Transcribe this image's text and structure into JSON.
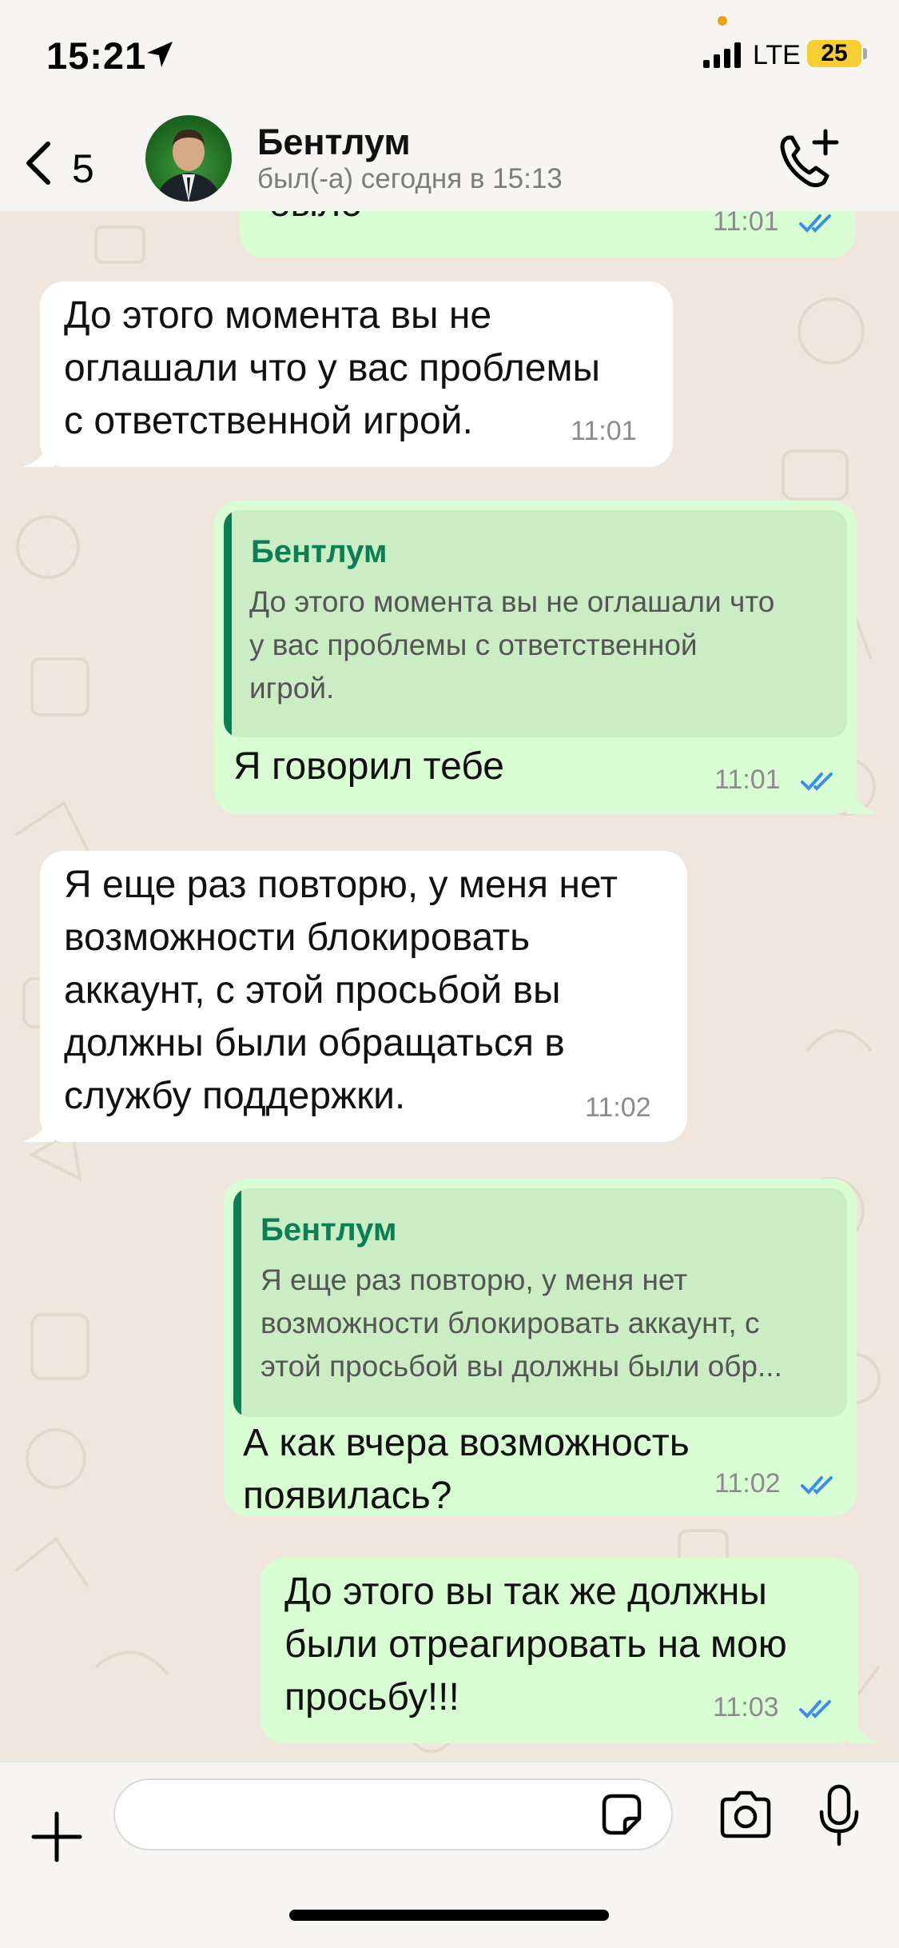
{
  "status_bar": {
    "time": "15:21",
    "network": "LTE",
    "battery": "25"
  },
  "header": {
    "back_count": "5",
    "contact_name": "Бентлум",
    "contact_status": "был(-а) сегодня в 15:13"
  },
  "messages": [
    {
      "direction": "out",
      "text": "было",
      "time": "11:01",
      "read": true
    },
    {
      "direction": "in",
      "text": "До этого момента вы не\nоглашали что у вас проблемы\nс ответственной игрой.",
      "time": "11:01"
    },
    {
      "direction": "out",
      "quote": {
        "author": "Бентлум",
        "text": "До этого момента вы не оглашали что\nу вас проблемы с ответственной\nигрой."
      },
      "text": "Я говорил тебе",
      "time": "11:01",
      "read": true
    },
    {
      "direction": "in",
      "text": "Я еще раз повторю, у меня нет\nвозможности блокировать\nаккаунт, с этой просьбой вы\nдолжны были обращаться в\nслужбу поддержки.",
      "time": "11:02"
    },
    {
      "direction": "out",
      "quote": {
        "author": "Бентлум",
        "text": "Я еще раз повторю, у меня нет\nвозможности блокировать аккаунт, с\nэтой просьбой вы должны были обр..."
      },
      "text": "А как вчера возможность\nпоявилась?",
      "time": "11:02",
      "read": true
    },
    {
      "direction": "out",
      "text": "До этого вы так же должны\nбыли отреагировать на мою\nпросьбу!!!",
      "time": "11:03",
      "read": true
    }
  ],
  "input": {
    "value": "",
    "placeholder": ""
  },
  "icons": {
    "back": "chevron-left-icon",
    "call": "phone-plus-icon",
    "add": "plus-icon",
    "sticker": "sticker-icon",
    "camera": "camera-icon",
    "mic": "microphone-icon",
    "ticks": "double-check-icon"
  },
  "colors": {
    "outgoing_bubble": "#d9fdd3",
    "incoming_bubble": "#ffffff",
    "quote_accent": "#0a7e55",
    "read_ticks": "#3a8ee8",
    "battery": "#f7cf31"
  }
}
